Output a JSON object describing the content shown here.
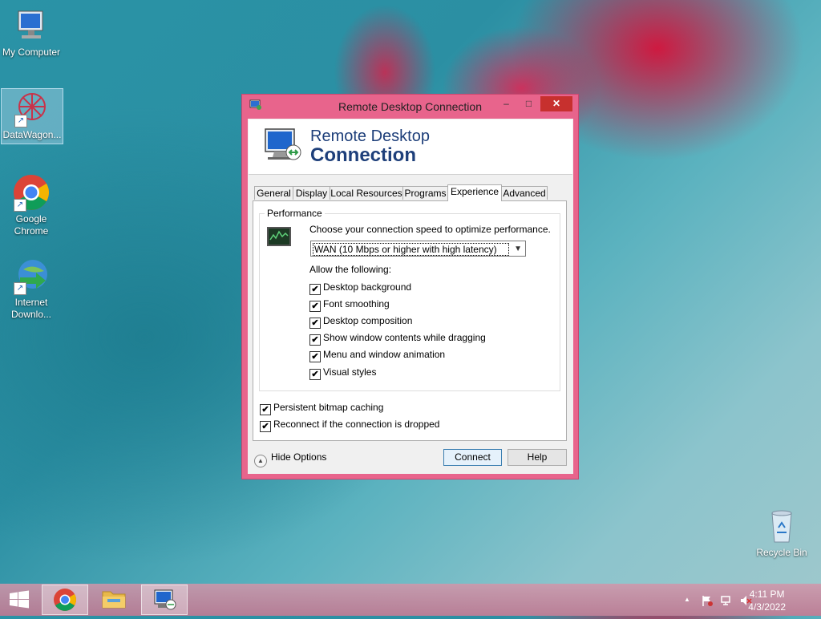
{
  "desktop": {
    "icons": [
      {
        "label": "My Computer"
      },
      {
        "label": "DataWagon..."
      },
      {
        "label": "Google Chrome"
      },
      {
        "label": "Internet Downlo..."
      },
      {
        "label": "Recycle Bin"
      }
    ]
  },
  "window": {
    "title": "Remote Desktop Connection",
    "controls": {
      "minimize": "–",
      "maximize": "□",
      "close": "✕"
    },
    "banner": {
      "line1": "Remote Desktop",
      "line2": "Connection"
    },
    "tabs": [
      {
        "label": "General"
      },
      {
        "label": "Display"
      },
      {
        "label": "Local Resources"
      },
      {
        "label": "Programs"
      },
      {
        "label": "Experience",
        "active": true
      },
      {
        "label": "Advanced"
      }
    ],
    "performance": {
      "group_label": "Performance",
      "instruction": "Choose your connection speed to optimize performance.",
      "speed_value": "WAN (10 Mbps or higher with high latency)",
      "allow_label": "Allow the following:",
      "options": [
        {
          "label": "Desktop background",
          "checked": true
        },
        {
          "label": "Font smoothing",
          "checked": true
        },
        {
          "label": "Desktop composition",
          "checked": true
        },
        {
          "label": "Show window contents while dragging",
          "checked": true
        },
        {
          "label": "Menu and window animation",
          "checked": true
        },
        {
          "label": "Visual styles",
          "checked": true
        }
      ]
    },
    "persistent_bitmap": {
      "label": "Persistent bitmap caching",
      "checked": true
    },
    "reconnect": {
      "label": "Reconnect if the connection is dropped",
      "checked": true
    },
    "hide_options": "Hide Options",
    "connect_button": "Connect",
    "help_button": "Help",
    "check_glyph": "✔"
  },
  "taskbar": {
    "time": "4:11 PM",
    "date": "4/3/2022",
    "tray_arrow": "▲"
  },
  "colors": {
    "accent": "#e8648c",
    "close": "#c7302e",
    "banner_text": "#1e3f7a"
  }
}
